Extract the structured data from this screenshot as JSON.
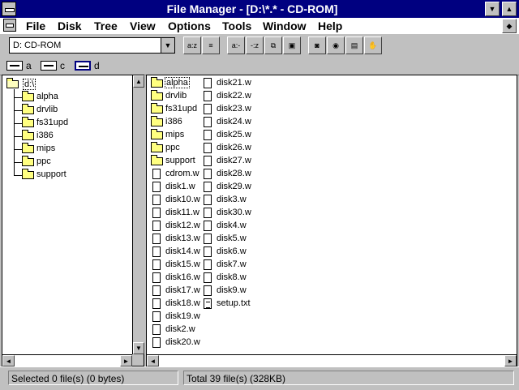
{
  "window": {
    "title": "File Manager - [D:\\*.* - CD-ROM]"
  },
  "menu": [
    "File",
    "Disk",
    "Tree",
    "View",
    "Options",
    "Tools",
    "Window",
    "Help"
  ],
  "toolbar": {
    "drive_combo": "D: CD-ROM"
  },
  "drives": [
    {
      "letter": "a",
      "type": "floppy"
    },
    {
      "letter": "c",
      "type": "hard-disk"
    },
    {
      "letter": "d",
      "type": "cd-rom",
      "selected": true
    }
  ],
  "tree": {
    "root": "d:\\",
    "folders": [
      "alpha",
      "drvlib",
      "fs31upd",
      "i386",
      "mips",
      "ppc",
      "support"
    ]
  },
  "files": {
    "column1": [
      {
        "name": "alpha",
        "type": "folder"
      },
      {
        "name": "drvlib",
        "type": "folder"
      },
      {
        "name": "fs31upd",
        "type": "folder"
      },
      {
        "name": "i386",
        "type": "folder"
      },
      {
        "name": "mips",
        "type": "folder"
      },
      {
        "name": "ppc",
        "type": "folder"
      },
      {
        "name": "support",
        "type": "folder"
      },
      {
        "name": "cdrom.w",
        "type": "file"
      },
      {
        "name": "disk1.w",
        "type": "file"
      },
      {
        "name": "disk10.w",
        "type": "file"
      },
      {
        "name": "disk11.w",
        "type": "file"
      },
      {
        "name": "disk12.w",
        "type": "file"
      },
      {
        "name": "disk13.w",
        "type": "file"
      },
      {
        "name": "disk14.w",
        "type": "file"
      },
      {
        "name": "disk15.w",
        "type": "file"
      },
      {
        "name": "disk16.w",
        "type": "file"
      },
      {
        "name": "disk17.w",
        "type": "file"
      },
      {
        "name": "disk18.w",
        "type": "file"
      },
      {
        "name": "disk19.w",
        "type": "file"
      },
      {
        "name": "disk2.w",
        "type": "file"
      },
      {
        "name": "disk20.w",
        "type": "file"
      }
    ],
    "column2": [
      {
        "name": "disk21.w",
        "type": "file"
      },
      {
        "name": "disk22.w",
        "type": "file"
      },
      {
        "name": "disk23.w",
        "type": "file"
      },
      {
        "name": "disk24.w",
        "type": "file"
      },
      {
        "name": "disk25.w",
        "type": "file"
      },
      {
        "name": "disk26.w",
        "type": "file"
      },
      {
        "name": "disk27.w",
        "type": "file"
      },
      {
        "name": "disk28.w",
        "type": "file"
      },
      {
        "name": "disk29.w",
        "type": "file"
      },
      {
        "name": "disk3.w",
        "type": "file"
      },
      {
        "name": "disk30.w",
        "type": "file"
      },
      {
        "name": "disk4.w",
        "type": "file"
      },
      {
        "name": "disk5.w",
        "type": "file"
      },
      {
        "name": "disk6.w",
        "type": "file"
      },
      {
        "name": "disk7.w",
        "type": "file"
      },
      {
        "name": "disk8.w",
        "type": "file"
      },
      {
        "name": "disk9.w",
        "type": "file"
      },
      {
        "name": "setup.txt",
        "type": "text"
      }
    ]
  },
  "status": {
    "selected": "Selected 0 file(s) (0 bytes)",
    "total": "Total 39 file(s) (328KB)"
  }
}
